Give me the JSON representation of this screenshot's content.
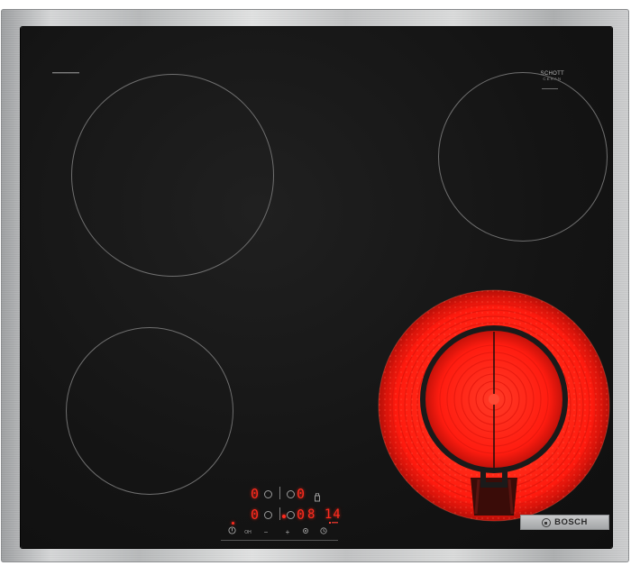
{
  "appliance": {
    "brand": "BOSCH",
    "glass_marking": {
      "line1": "SCHOTT",
      "line2": "CERAN"
    },
    "zones": [
      {
        "name": "zone-top-left",
        "state": "off"
      },
      {
        "name": "zone-top-right",
        "state": "off"
      },
      {
        "name": "zone-bottom-left",
        "state": "off"
      },
      {
        "name": "zone-bottom-right",
        "state": "on",
        "type": "dual-circuit",
        "glow_color": "#ff1a12"
      }
    ]
  },
  "display": {
    "row1": {
      "left": "0",
      "right": "0"
    },
    "row2": {
      "left": "0",
      "right": "0",
      "timer": "8 14"
    }
  },
  "controls": {
    "power": "⏻",
    "on_label": "OH",
    "minus": "−",
    "plus": "+",
    "timer": "◷"
  },
  "colors": {
    "glass": "#141414",
    "frame": "#c8c9ca",
    "led": "#ff2b1f"
  }
}
